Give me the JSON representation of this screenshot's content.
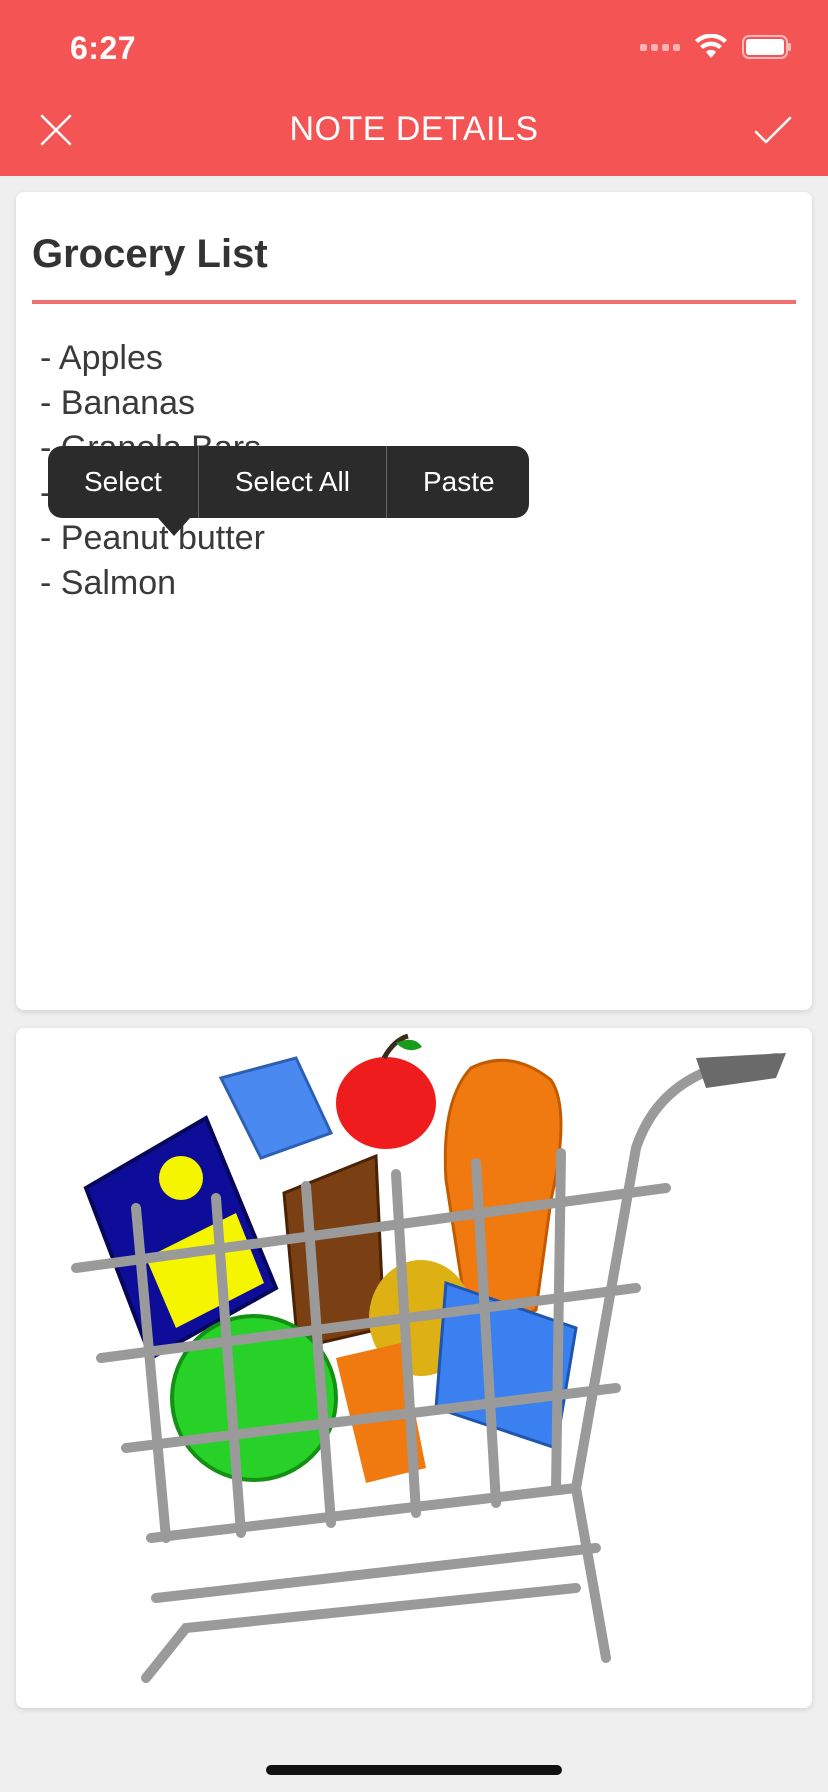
{
  "status_bar": {
    "time": "6:27"
  },
  "header": {
    "title": "NOTE DETAILS",
    "close_icon": "close-icon",
    "save_icon": "checkmark-icon",
    "color": "#f55454"
  },
  "note": {
    "title": "Grocery List",
    "lines": [
      "- Apples",
      "- Bananas",
      "- Granola Bars",
      "- ",
      "- Peanut butter",
      "- Salmon"
    ]
  },
  "context_menu": {
    "items": [
      "Select",
      "Select All",
      "Paste"
    ]
  },
  "image": {
    "subject": "shopping-cart-icon"
  }
}
